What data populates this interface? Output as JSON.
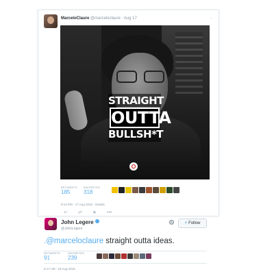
{
  "tweet1": {
    "display_name": "MarceloClaure",
    "meta": "@marceloclaure · Aug 17",
    "image_text": [
      "STRAIGHT",
      "OUTTA",
      "BULLSH*T"
    ],
    "retweets_label": "RETWEETS",
    "retweets": "185",
    "favorites_label": "FAVORITES",
    "favorites": "318",
    "timestamp": "9:14 PM - 17 Aug 2015 · Details",
    "icons": [
      "reply-icon",
      "retweet-icon",
      "favorite-icon",
      "more-icon"
    ]
  },
  "tweet2": {
    "display_name": "John Legere",
    "handle": "@JohnLegere",
    "follow_label": "Follow",
    "text_mention": ".@marceloclaure",
    "text_rest": " straight outta ideas.",
    "retweets_label": "RETWEETS",
    "retweets": "91",
    "favorites_label": "FAVORITES",
    "favorites": "239",
    "timestamp": "6:17 AM - 18 Aug 2015"
  },
  "colors": {
    "link": "#55acee",
    "muted": "#8899a6",
    "border": "#e1e8ed",
    "text": "#292f33"
  }
}
